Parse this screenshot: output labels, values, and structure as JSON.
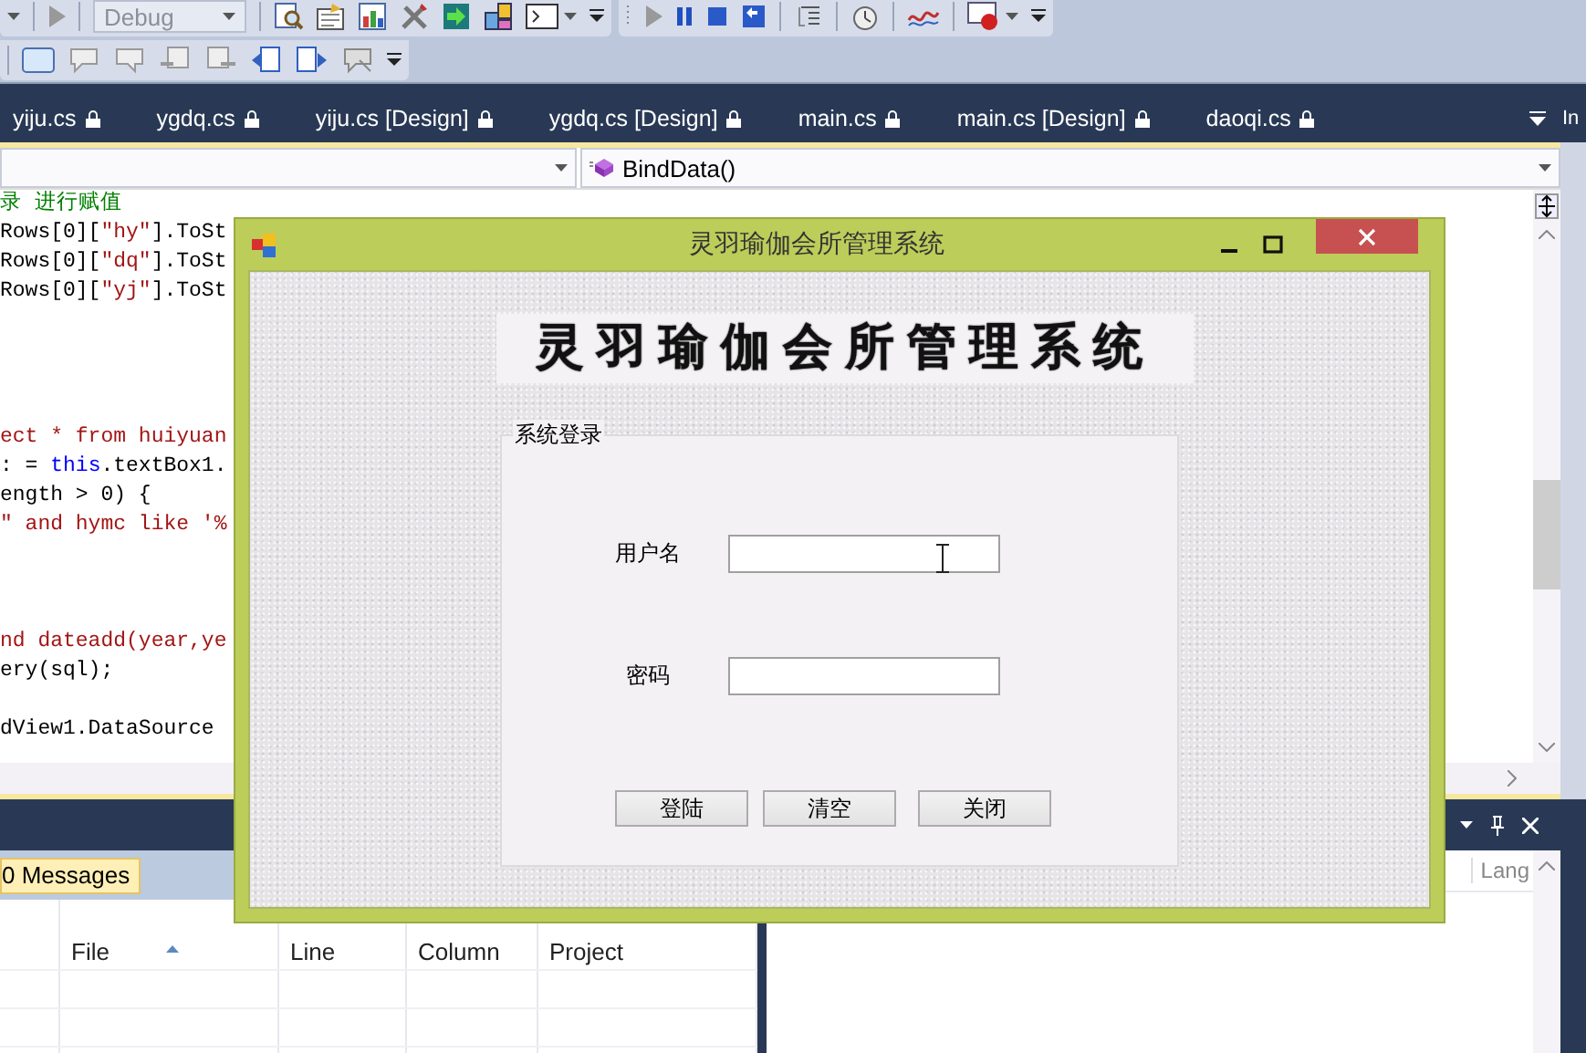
{
  "toolbar": {
    "configuration": "Debug"
  },
  "tabs": [
    {
      "label": "yiju.cs",
      "selected": false
    },
    {
      "label": "ygdq.cs",
      "selected": false
    },
    {
      "label": "yiju.cs [Design]",
      "selected": false
    },
    {
      "label": "ygdq.cs [Design]",
      "selected": false
    },
    {
      "label": "main.cs",
      "selected": false
    },
    {
      "label": "main.cs [Design]",
      "selected": false
    },
    {
      "label": "daoqi.cs",
      "selected": false
    }
  ],
  "side_panel": {
    "title": "In"
  },
  "navigation_bar": {
    "member": "BindData()"
  },
  "code_lines": [
    {
      "kind": "code",
      "segments": [
        {
          "kind": "comment",
          "text": "录 进行赋值"
        }
      ]
    },
    {
      "kind": "code",
      "segments": [
        {
          "kind": "plain",
          "text": "Rows[0]["
        },
        {
          "kind": "string",
          "text": "\"hy\""
        },
        {
          "kind": "plain",
          "text": "].ToSt"
        }
      ]
    },
    {
      "kind": "code",
      "segments": [
        {
          "kind": "plain",
          "text": "Rows[0]["
        },
        {
          "kind": "string",
          "text": "\"dq\""
        },
        {
          "kind": "plain",
          "text": "].ToSt"
        }
      ]
    },
    {
      "kind": "code",
      "segments": [
        {
          "kind": "plain",
          "text": "Rows[0]["
        },
        {
          "kind": "string",
          "text": "\"yj\""
        },
        {
          "kind": "plain",
          "text": "].ToSt"
        }
      ]
    },
    {
      "kind": "blank"
    },
    {
      "kind": "blank"
    },
    {
      "kind": "blank"
    },
    {
      "kind": "blank"
    },
    {
      "kind": "code",
      "segments": [
        {
          "kind": "string",
          "text": "ect * from huiyuan"
        }
      ]
    },
    {
      "kind": "code",
      "segments": [
        {
          "kind": "plain",
          "text": ": = "
        },
        {
          "kind": "keyword",
          "text": "this"
        },
        {
          "kind": "plain",
          "text": ".textBox1."
        }
      ]
    },
    {
      "kind": "code",
      "segments": [
        {
          "kind": "plain",
          "text": "ength > 0) {"
        }
      ]
    },
    {
      "kind": "code",
      "segments": [
        {
          "kind": "string",
          "text": "\" and hymc like '%"
        }
      ]
    },
    {
      "kind": "blank"
    },
    {
      "kind": "blank"
    },
    {
      "kind": "blank"
    },
    {
      "kind": "code",
      "segments": [
        {
          "kind": "string",
          "text": "nd dateadd(year,ye"
        }
      ]
    },
    {
      "kind": "code",
      "segments": [
        {
          "kind": "plain",
          "text": "ery(sql);"
        }
      ]
    },
    {
      "kind": "blank"
    },
    {
      "kind": "code",
      "segments": [
        {
          "kind": "plain",
          "text": "dView1.DataSource"
        }
      ]
    }
  ],
  "error_list": {
    "messages_button": "0 Messages",
    "columns": [
      {
        "label": "File",
        "sorted": true
      },
      {
        "label": "Line",
        "sorted": false
      },
      {
        "label": "Column",
        "sorted": false
      },
      {
        "label": "Project",
        "sorted": false
      }
    ]
  },
  "right_panel": {
    "columns": [
      "Lang"
    ]
  },
  "dialog": {
    "title": "灵羽瑜伽会所管理系统",
    "banner": "灵羽瑜伽会所管理系统",
    "group_title": "系统登录",
    "fields": [
      {
        "label": "用户名"
      },
      {
        "label": "密码"
      }
    ],
    "buttons": [
      "登陆",
      "清空",
      "关闭"
    ]
  }
}
